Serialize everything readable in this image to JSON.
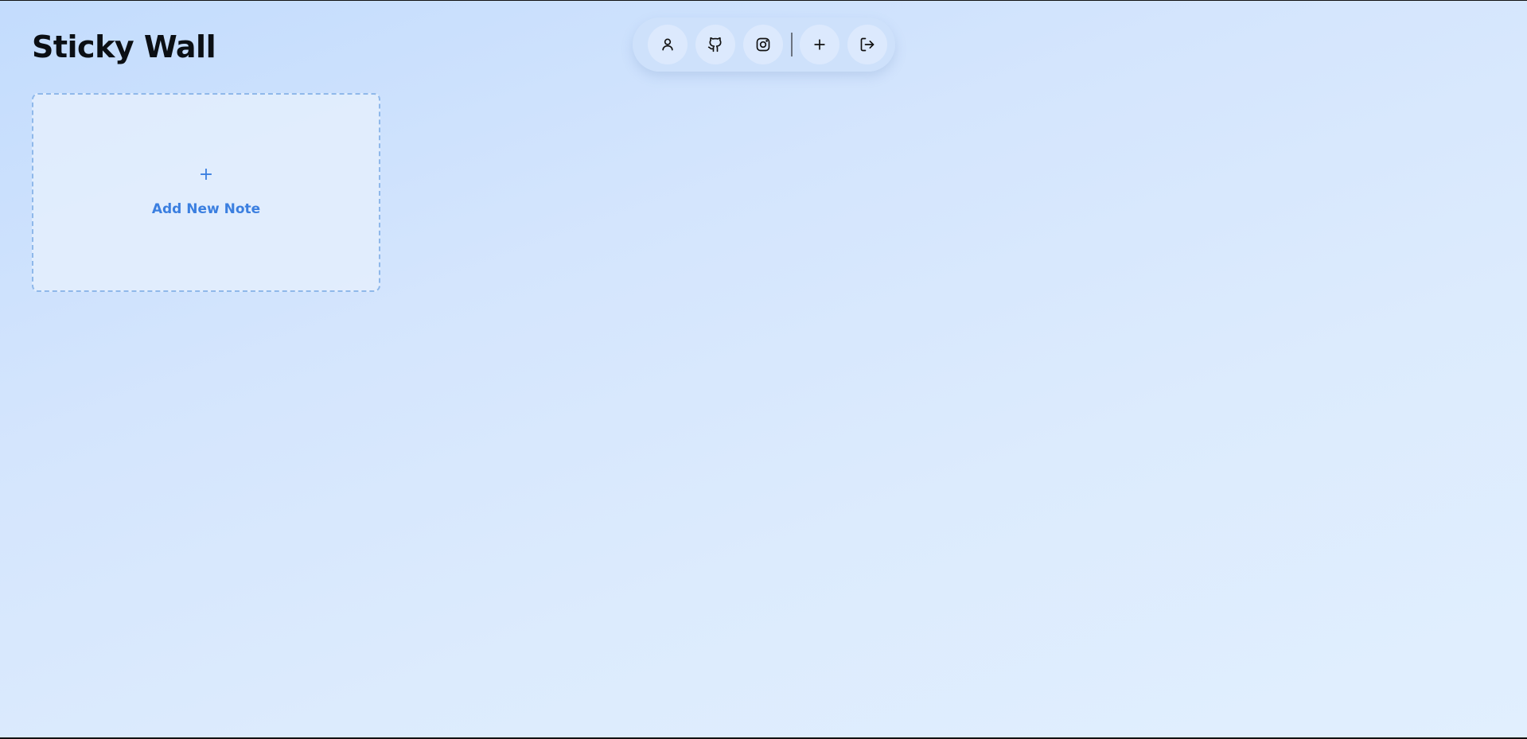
{
  "page": {
    "title": "Sticky Wall",
    "background_colors": [
      "#c3dcfd",
      "#e1effe"
    ]
  },
  "toolbar": {
    "buttons": [
      {
        "icon": "user-icon"
      },
      {
        "icon": "github-icon"
      },
      {
        "icon": "instagram-icon"
      },
      {
        "icon": "plus-icon"
      },
      {
        "icon": "logout-icon"
      }
    ]
  },
  "add_card": {
    "plus_symbol": "+",
    "label": "Add New Note",
    "accent_color": "#3b7fe0"
  }
}
